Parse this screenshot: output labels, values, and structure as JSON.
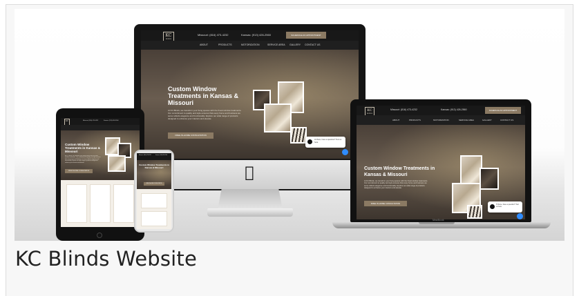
{
  "caption": "KC Blinds Website",
  "site": {
    "logo_text": "KC",
    "logo_sub": "BLINDS",
    "phone_missouri": "Missouri: (816) 473-4232",
    "phone_kansas": "Kansas: (913) 426-2560",
    "cta_schedule": "SCHEDULE AN APPOINTMENT",
    "nav": [
      "ABOUT",
      "PRODUCTS",
      "MOTORIZATION",
      "SERVICE AREA",
      "GALLERY",
      "CONTACT US"
    ],
    "hero_title_short": "Custom Window Treatments in Kansas & Missouri",
    "hero_title_wide": "Custom Window Treatments in Kansas & Missouri",
    "hero_body": "At KC Blinds, we transform your living spaces with the finest window treatments. Our commitment to quality and style ensures that every home and business we serve reflects elegance and functionality. Explore our wide range of products designed to enhance your interiors and elevate.",
    "hero_cta": "FREE IN-HOME CONSULTATION",
    "chat_message": "Hi there, have a question? Text us here.",
    "laptop_brand": "MacBook"
  },
  "colors": {
    "accent": "#8b7a63",
    "chat_button": "#2f8cff",
    "dark_bar": "#181818"
  }
}
